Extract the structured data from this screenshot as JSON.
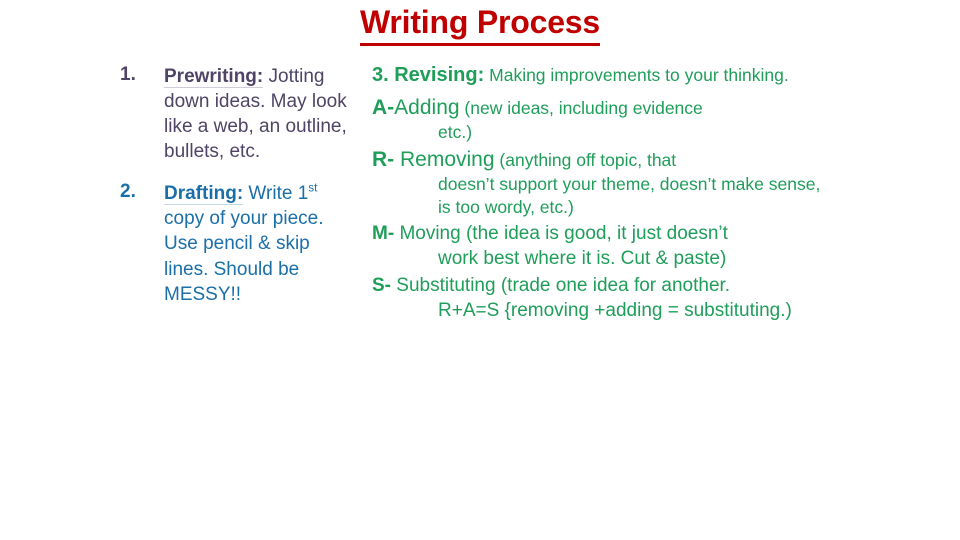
{
  "slide": {
    "title": "Writing Process",
    "colors": {
      "title": "#C00000",
      "step1": "#4F4466",
      "step2": "#1B6FA8",
      "revising": "#1F9E5A",
      "background": "#FFFFFF"
    }
  },
  "left_column": {
    "items": [
      {
        "number": "1.",
        "lead": "Prewriting:",
        "body": "Jotting down ideas. May look like a web, an outline, bullets, etc."
      },
      {
        "number": "2.",
        "lead": "Drafting:",
        "body_before_sup": " Write 1",
        "sup": "st",
        "body_after_sup": " copy of your piece. Use pencil & skip lines. Should be MESSY!!"
      }
    ]
  },
  "right_column": {
    "heading": {
      "number_label": "3. Revising:",
      "description": " Making improvements to your thinking."
    },
    "strategies": [
      {
        "letter": "A-",
        "name": "Adding",
        "detail": " (new ideas, including evidence",
        "continuation": "etc.)"
      },
      {
        "letter": "R- ",
        "name": "Removing",
        "detail": " (anything off topic, that",
        "continuation": "doesn’t support your theme, doesn’t make sense, is too wordy, etc.)"
      },
      {
        "letter": "M- ",
        "name": "Moving",
        "detail": " (the idea is good, it just doesn’t",
        "continuation": "work best where it is. Cut & paste)"
      },
      {
        "letter": "S- ",
        "name": "Substituting",
        "detail": " (trade one idea for another.",
        "continuation": "R+A=S {removing +adding = substituting.)"
      }
    ]
  }
}
